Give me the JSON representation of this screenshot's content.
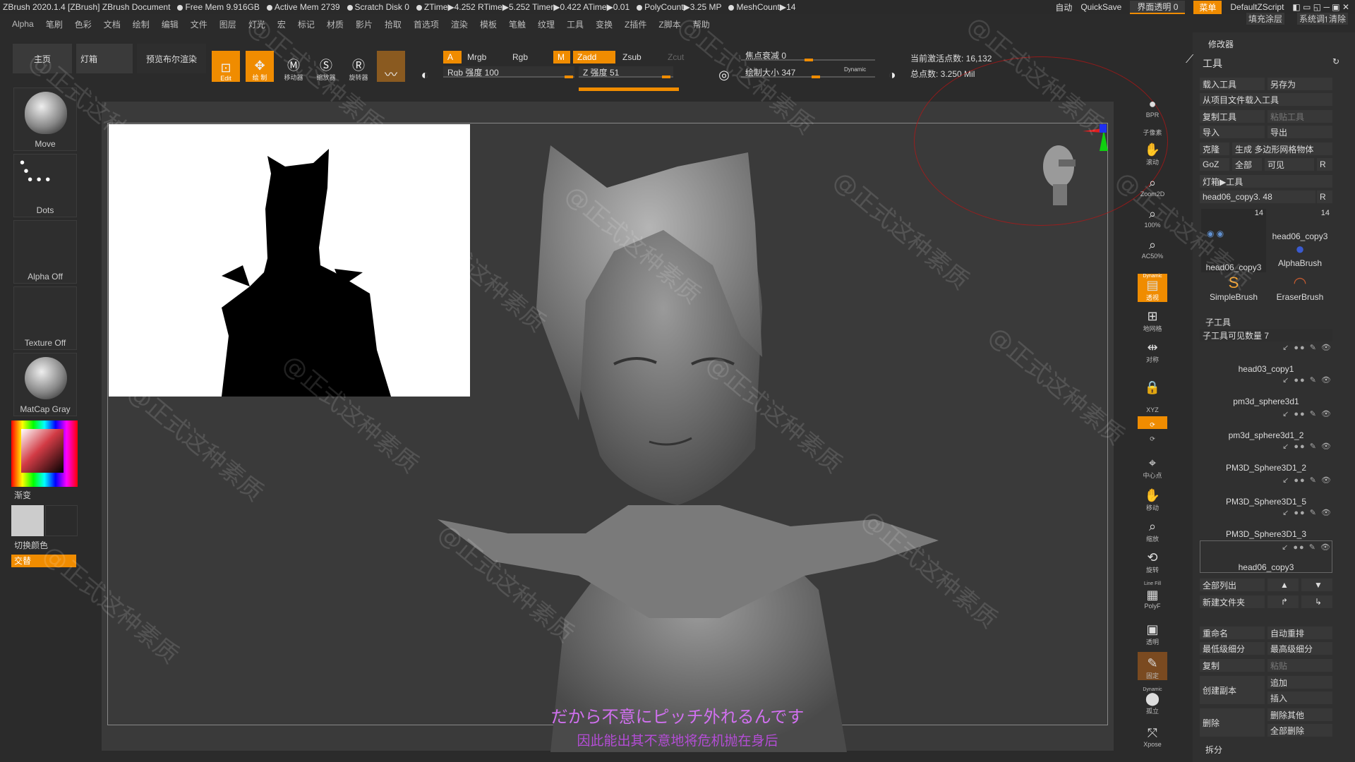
{
  "titlebar": {
    "app_title": "ZBrush 2020.1.4 [ZBrush]   ZBrush Document",
    "stats": [
      "Free Mem 9.916GB",
      "Active Mem 2739",
      "Scratch Disk 0",
      "ZTime▶4.252 RTime▶5.252 Timer▶0.422 ATime▶0.01",
      "PolyCount▶3.25 MP",
      "MeshCount▶14"
    ],
    "auto": "自动",
    "quicksave": "QuickSave",
    "transparency": "界面透明 0",
    "menu": "菜单",
    "script": "DefaultZScript"
  },
  "menubar": [
    "Alpha",
    "笔刷",
    "色彩",
    "文档",
    "绘制",
    "编辑",
    "文件",
    "图层",
    "灯光",
    "宏",
    "标记",
    "材质",
    "影片",
    "拾取",
    "首选项",
    "渲染",
    "模板",
    "笔触",
    "纹理",
    "工具",
    "变换",
    "Z插件",
    "Z脚本",
    "帮助"
  ],
  "toolbar": {
    "home": "主页",
    "lightbox": "灯箱",
    "preview_render": "预览布尔渲染",
    "edit": "Edit",
    "draw": "绘 制",
    "move": "移动器",
    "scale": "缩放器",
    "rotate": "旋转器",
    "a": "A",
    "mrgb": "Mrgb",
    "rgb": "Rgb",
    "m": "M",
    "zadd": "Zadd",
    "zsub": "Zsub",
    "zcut": "Zcut",
    "rgb_intensity": "Rgb 强度 100",
    "z_intensity": "Z 强度 51",
    "focal": "焦点衰减 0",
    "draw_size": "绘制大小 347",
    "dynamic": "Dynamic",
    "active_points": "当前激活点数: 16,132",
    "total_points": "总点数: 3.250 Mil"
  },
  "leftshelf": {
    "brush": "Move",
    "stroke": "Dots",
    "alpha": "Alpha Off",
    "texture": "Texture Off",
    "material": "MatCap Gray",
    "gradient": "渐变",
    "switch_color": "切换颜色",
    "alternate": "交替"
  },
  "viewport": {
    "subtitle_jp": "だから不意にピッチ外れるんです",
    "subtitle_cn": "因此能出其不意地将危机抛在身后",
    "watermark": "@正式这种素质"
  },
  "rightcol": [
    "BPR",
    "子像素",
    "滚动",
    "Zoom2D",
    "100%",
    "AC50%",
    "透视",
    "地网格",
    "对称",
    "XYZ",
    "",
    "",
    "中心点",
    "移动",
    "缩放",
    "旋转",
    "PolyF",
    "透明",
    "固定",
    "孤立",
    "Xpose"
  ],
  "rightcol_labels": {
    "line_fill": "Line Fill",
    "dynamic": "Dynamic"
  },
  "rpanel": {
    "top_buttons": [
      "填充涂层",
      "系统调色板",
      "清除"
    ],
    "modifier": "修改器",
    "tool": "工具",
    "load_tool": "载入工具",
    "save_as": "另存为",
    "load_from_project": "从项目文件载入工具",
    "copy_tool": "复制工具",
    "paste_tool": "粘贴工具",
    "import": "导入",
    "export": "导出",
    "clone": "克隆",
    "make_polymesh": "生成 多边形网格物体",
    "goz": "GoZ",
    "all": "全部",
    "visible": "可见",
    "r": "R",
    "lightbox_tools": "灯箱▶工具",
    "current_tool": "head06_copy3. 48",
    "brushes": [
      {
        "name": "head06_copy3",
        "num": "14"
      },
      {
        "name": "head06_copy3",
        "num": "14"
      },
      {
        "name": "AlphaBrush",
        "num": ""
      },
      {
        "name": "SimpleBrush",
        "num": ""
      },
      {
        "name": "EraserBrush",
        "num": ""
      }
    ],
    "subtool": "子工具",
    "visible_count": "子工具可见数量 7",
    "subtools": [
      "head03_copy1",
      "pm3d_sphere3d1",
      "pm3d_sphere3d1_2",
      "PM3D_Sphere3D1_2",
      "PM3D_Sphere3D1_5",
      "PM3D_Sphere3D1_3",
      "head06_copy3"
    ],
    "list_all": "全部列出",
    "new_folder": "新建文件夹",
    "rename": "重命名",
    "auto_reorder": "自动重排",
    "lowest_subdiv": "最低级细分",
    "highest_subdiv": "最高级细分",
    "duplicate": "复制",
    "paste": "粘贴",
    "append": "追加",
    "create_copy": "创建副本",
    "insert": "插入",
    "delete": "删除",
    "delete_other": "删除其他",
    "delete_all": "全部删除",
    "split": "拆分"
  }
}
